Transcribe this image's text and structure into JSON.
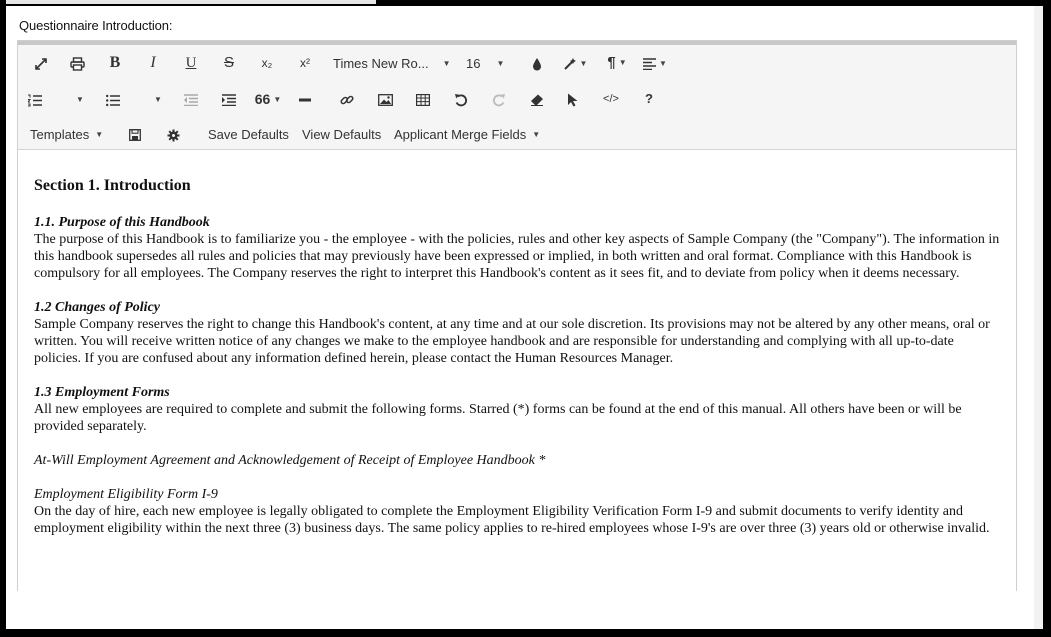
{
  "label": "Questionnaire Introduction:",
  "toolbar": {
    "font_name": "Times New Ro...",
    "font_size": "16",
    "templates": "Templates",
    "save_defaults": "Save Defaults",
    "view_defaults": "View Defaults",
    "merge_fields": "Applicant Merge Fields",
    "icons": {
      "bold": "B",
      "italic": "I",
      "underline": "U",
      "strike": "S",
      "subscript": "x₂",
      "superscript": "x²",
      "blockquote": "66",
      "paragraph": "¶",
      "source": "</>",
      "help": "?"
    }
  },
  "document": {
    "heading": "Section 1. Introduction",
    "s1_title": "1.1. Purpose of this Handbook",
    "s1_body": "The purpose of this Handbook is to familiarize you - the employee - with the policies, rules and other key aspects of Sample Company (the \"Company\"). The information in this handbook supersedes all rules and policies that may previously have been expressed or implied, in both written and oral format. Compliance with this Handbook is compulsory for all employees. The Company reserves the right to interpret this Handbook's content as it sees fit, and to deviate from policy when it deems necessary.",
    "s2_title": "1.2 Changes of Policy",
    "s2_body": "Sample Company reserves the right to change this Handbook's content, at any time and at our sole discretion. Its provisions may not be altered by any other means, oral or written. You will receive written notice of any changes we make to the employee handbook and are responsible for understanding and complying with all up-to-date policies. If you are confused about any information defined herein, please contact the Human Resources Manager.",
    "s3_title": "1.3 Employment Forms",
    "s3_body": "All new employees are required to complete and submit the following forms. Starred (*) forms can be found at the end of this manual. All others have been or will be provided separately.",
    "form1": "At-Will Employment Agreement and Acknowledgement of Receipt of Employee Handbook *",
    "form2_title": "Employment Eligibility Form I-9",
    "form2_body": "On the day of hire, each new employee is legally obligated to complete the Employment Eligibility Verification Form I-9 and submit documents to verify identity and employment eligibility within the next three (3) business days. The same policy applies to re-hired employees whose I-9's are over three (3) years old or otherwise invalid."
  }
}
